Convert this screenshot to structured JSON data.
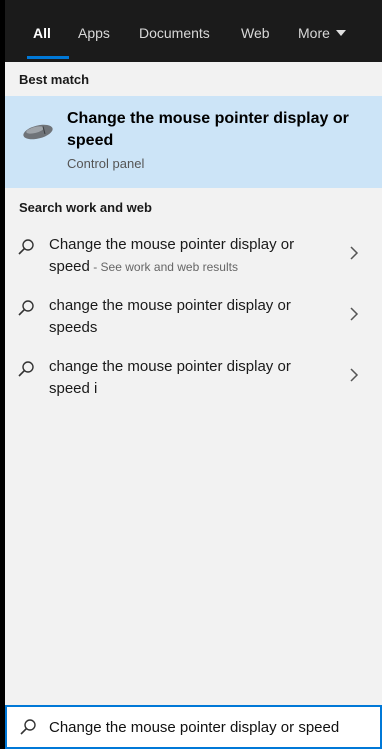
{
  "tabs": [
    {
      "label": "All",
      "active": true
    },
    {
      "label": "Apps"
    },
    {
      "label": "Documents"
    },
    {
      "label": "Web"
    },
    {
      "label": "More"
    }
  ],
  "best_match": {
    "heading": "Best match",
    "title": "Change the mouse pointer display or speed",
    "subtitle": "Control panel",
    "icon": "mouse-icon"
  },
  "web": {
    "heading": "Search work and web",
    "results": [
      {
        "text": "Change the mouse pointer display or speed",
        "hint": " - See work and web results"
      },
      {
        "text": "change the mouse pointer display or speeds",
        "hint": ""
      },
      {
        "text": "change the mouse pointer display or speed i",
        "hint": ""
      }
    ]
  },
  "search": {
    "value": "Change the mouse pointer display or speed"
  },
  "colors": {
    "accent": "#0078d7",
    "highlight": "#cce4f7",
    "tabbar": "#1b1b1b",
    "panel": "#f2f2f2"
  }
}
